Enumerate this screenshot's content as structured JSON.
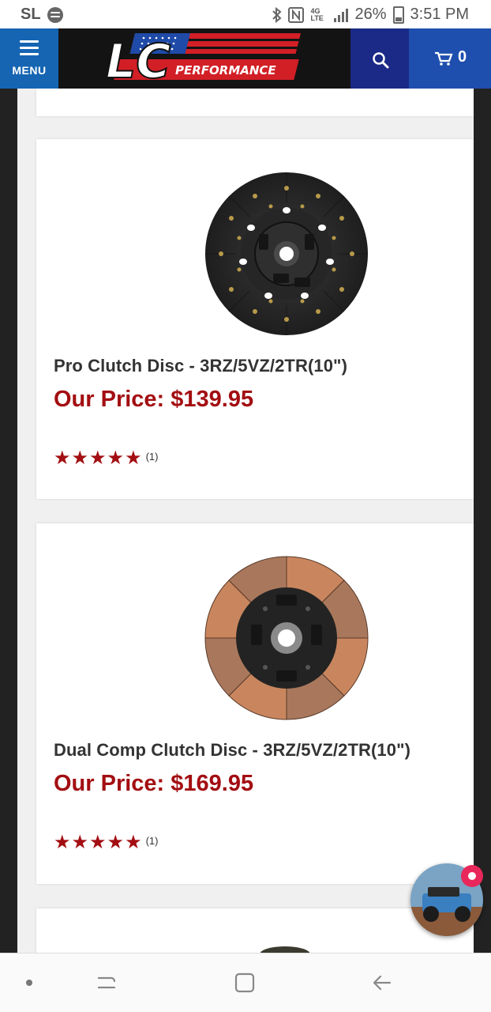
{
  "status_bar": {
    "carrier": "SL",
    "network": "4G LTE",
    "battery": "26%",
    "time": "3:51 PM"
  },
  "header": {
    "menu_label": "MENU",
    "logo_letters": "LC",
    "logo_text": "PERFORMANCE",
    "cart_count": "0"
  },
  "products": [
    {
      "title": "Pro Clutch Disc - 3RZ/5VZ/2TR(10\")",
      "price": "Our Price: $139.95",
      "rating": 5,
      "review_count": "(1)"
    },
    {
      "title": "Dual Comp Clutch Disc - 3RZ/5VZ/2TR(10\")",
      "price": "Our Price: $169.95",
      "rating": 5,
      "review_count": "(1)"
    }
  ],
  "colors": {
    "price_red": "#a30e12",
    "menu_blue": "#1565b3",
    "search_blue": "#1a2a86",
    "cart_blue": "#1e4fae",
    "chat_badge": "#e8285a"
  },
  "icons": [
    "spotify-icon",
    "bluetooth-icon",
    "nfc-icon",
    "signal-icon",
    "battery-icon",
    "menu-icon",
    "search-icon",
    "cart-icon",
    "star-icon",
    "chat-icon",
    "recent-apps-icon",
    "home-icon",
    "back-icon"
  ]
}
